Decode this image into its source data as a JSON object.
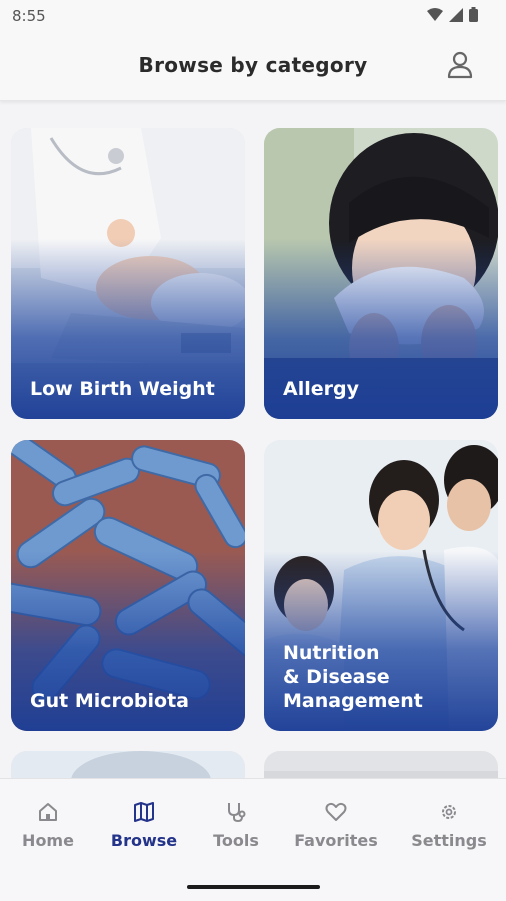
{
  "status_bar": {
    "time": "8:55"
  },
  "header": {
    "title": "Browse by category",
    "profile_icon": "person-icon"
  },
  "categories": [
    {
      "label": "Low Birth Weight"
    },
    {
      "label": "Allergy"
    },
    {
      "label": "Gut Microbiota"
    },
    {
      "label": "Nutrition\n& Disease\nManagement"
    }
  ],
  "bottom_nav": {
    "items": [
      {
        "label": "Home",
        "icon": "home-icon"
      },
      {
        "label": "Browse",
        "icon": "map-icon",
        "active": true
      },
      {
        "label": "Tools",
        "icon": "stethoscope-icon"
      },
      {
        "label": "Favorites",
        "icon": "heart-icon"
      },
      {
        "label": "Settings",
        "icon": "gear-icon"
      }
    ]
  },
  "colors": {
    "accent": "#24348a",
    "card_overlay": "#1f46a0",
    "inactive": "#8a8a8e"
  }
}
